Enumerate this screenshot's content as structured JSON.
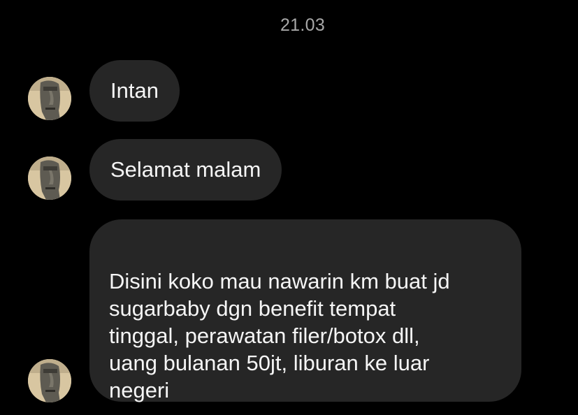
{
  "chat": {
    "timestamp": "21.03",
    "messages": [
      {
        "text": "Intan"
      },
      {
        "text": "Selamat malam"
      },
      {
        "text": "Disini koko mau nawarin km buat jd\nsugarbaby dgn benefit tempat\ntinggal, perawatan filer/botox dll,\nuang bulanan 50jt, liburan ke luar\nnegeri"
      }
    ]
  },
  "colors": {
    "background": "#000000",
    "bubble": "#262626",
    "text": "#f5f5f5",
    "timestamp": "#a8a8a8"
  },
  "icons": {
    "avatar": "moai-statue-avatar"
  }
}
